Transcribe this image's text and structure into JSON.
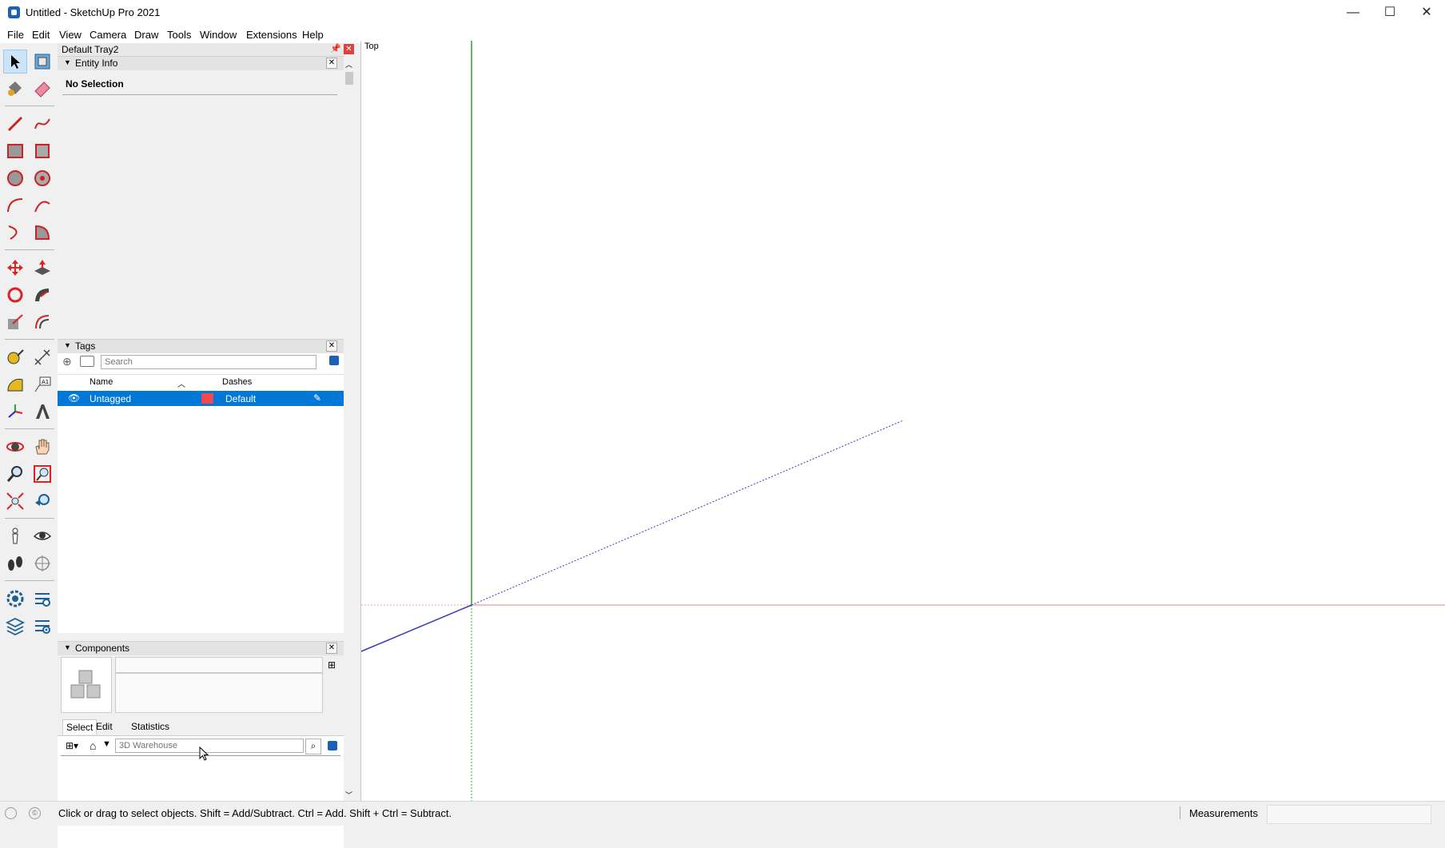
{
  "window": {
    "title": "Untitled - SketchUp Pro 2021",
    "min_glyph": "—",
    "max_glyph": "☐",
    "close_glyph": "✕"
  },
  "menu": [
    "File",
    "Edit",
    "View",
    "Camera",
    "Draw",
    "Tools",
    "Window",
    "Extensions",
    "Help"
  ],
  "tray": {
    "title": "Default Tray2",
    "entity_info": {
      "header": "Entity Info",
      "selection": "No Selection"
    },
    "tags": {
      "header": "Tags",
      "search_placeholder": "Search",
      "columns": {
        "name": "Name",
        "dashes": "Dashes"
      },
      "rows": [
        {
          "name": "Untagged",
          "color": "#f0484e",
          "dashes": "Default"
        }
      ]
    },
    "components": {
      "header": "Components",
      "tabs": [
        "Select",
        "Edit",
        "Statistics"
      ],
      "search_placeholder": "3D Warehouse"
    }
  },
  "viewport": {
    "view_label": "Top"
  },
  "status": {
    "hint": "Click or drag to select objects. Shift = Add/Subtract. Ctrl = Add. Shift + Ctrl = Subtract.",
    "measurements_label": "Measurements"
  },
  "colors": {
    "selection": "#0078d7",
    "axis_red": "#e8a0a0",
    "axis_green": "#2ea02e",
    "axis_blue": "#3a3ab8"
  }
}
